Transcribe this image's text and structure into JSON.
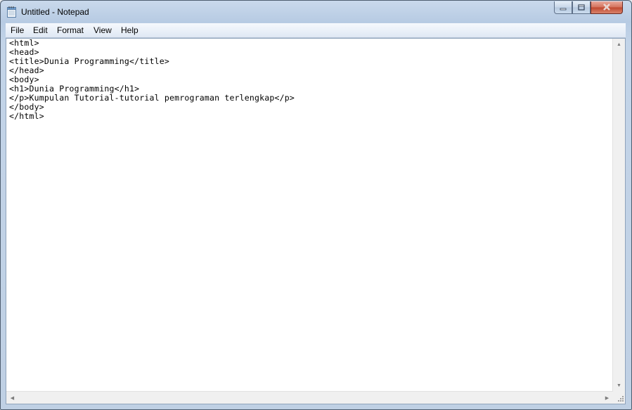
{
  "window": {
    "title": "Untitled - Notepad",
    "icon": "notepad-icon"
  },
  "caption_buttons": {
    "minimize_icon": "minimize-icon",
    "maximize_icon": "maximize-icon",
    "close_icon": "close-icon"
  },
  "menu": {
    "items": [
      {
        "label": "File"
      },
      {
        "label": "Edit"
      },
      {
        "label": "Format"
      },
      {
        "label": "View"
      },
      {
        "label": "Help"
      }
    ]
  },
  "editor": {
    "content": "<html>\n<head>\n<title>Dunia Programming</title>\n</head>\n<body>\n<h1>Dunia Programming</h1>\n</p>Kumpulan Tutorial-tutorial pemrograman terlengkap</p>\n</body>\n</html>"
  },
  "scrollbars": {
    "up_icon": "scroll-up-arrow-icon",
    "down_icon": "scroll-down-arrow-icon",
    "left_icon": "scroll-left-arrow-icon",
    "right_icon": "scroll-right-arrow-icon",
    "grip_icon": "resize-grip-icon"
  }
}
